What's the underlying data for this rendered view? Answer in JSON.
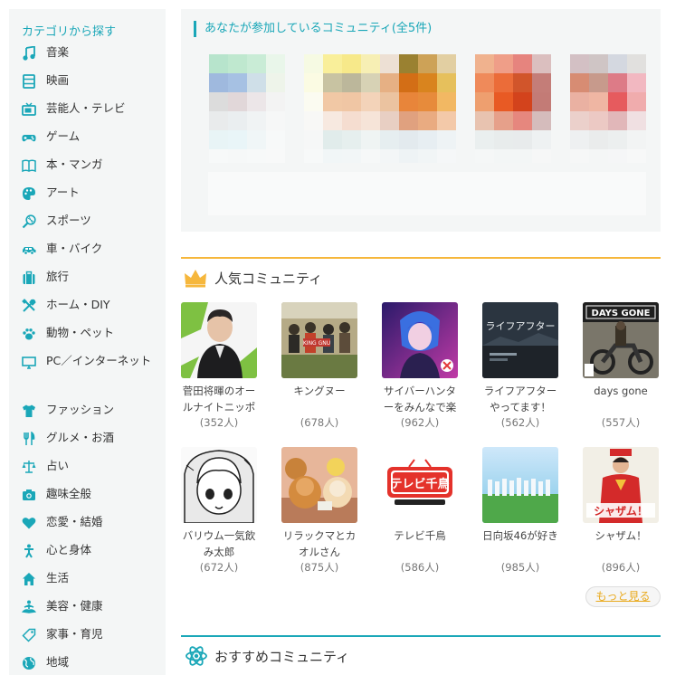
{
  "sidebar": {
    "title": "カテゴリから探す",
    "items": [
      {
        "label": "音楽",
        "icon": "music-note-icon"
      },
      {
        "label": "映画",
        "icon": "film-icon"
      },
      {
        "label": "芸能人・テレビ",
        "icon": "tv-icon"
      },
      {
        "label": "ゲーム",
        "icon": "gamepad-icon"
      },
      {
        "label": "本・マンガ",
        "icon": "book-icon"
      },
      {
        "label": "アート",
        "icon": "palette-icon"
      },
      {
        "label": "スポーツ",
        "icon": "racket-icon"
      },
      {
        "label": "車・バイク",
        "icon": "car-icon"
      },
      {
        "label": "旅行",
        "icon": "suitcase-icon"
      },
      {
        "label": "ホーム・DIY",
        "icon": "tools-icon"
      },
      {
        "label": "動物・ペット",
        "icon": "paw-icon"
      },
      {
        "label": "PC／インターネット",
        "icon": "computer-icon"
      },
      {
        "label": "ファッション",
        "icon": "tshirt-icon"
      },
      {
        "label": "グルメ・お酒",
        "icon": "fork-knife-icon"
      },
      {
        "label": "占い",
        "icon": "scales-icon"
      },
      {
        "label": "趣味全般",
        "icon": "camera-icon"
      },
      {
        "label": "恋愛・結婚",
        "icon": "heart-icon"
      },
      {
        "label": "心と身体",
        "icon": "person-icon"
      },
      {
        "label": "生活",
        "icon": "house-icon"
      },
      {
        "label": "美容・健康",
        "icon": "meditation-icon"
      },
      {
        "label": "家事・育児",
        "icon": "tag-icon"
      },
      {
        "label": "地域",
        "icon": "globe-icon"
      }
    ]
  },
  "joined": {
    "title": "あなたが参加しているコミュニティ(全5件)"
  },
  "popular": {
    "title": "人気コミュニティ",
    "icon": "crown-icon",
    "communities": [
      {
        "name": "菅田将暉のオールナイトニッポ",
        "count": "(352人)"
      },
      {
        "name": "キングヌー",
        "count": "(678人)"
      },
      {
        "name": "サイバーハンターをみんなで楽",
        "count": "(962人)"
      },
      {
        "name": "ライフアフターやってます！",
        "count": "(562人)"
      },
      {
        "name": "days gone",
        "count": "(557人)"
      },
      {
        "name": "バリウム一気飲み太郎",
        "count": "(672人)"
      },
      {
        "name": "リラックマとカオルさん",
        "count": "(875人)"
      },
      {
        "name": "テレビ千鳥",
        "count": "(586人)"
      },
      {
        "name": "日向坂46が好き",
        "count": "(985人)"
      },
      {
        "name": "シャザム！",
        "count": "(896人)"
      }
    ],
    "thumb_texts": {
      "kingnu": "KING GNU",
      "lifeafter": "ライフアフター",
      "daysgone": "DAYS GONE",
      "chidori": "テレビ千鳥",
      "shazam": "シャザム！"
    },
    "more_label": "もっと見る"
  },
  "recommend": {
    "title": "おすすめコミュニティ",
    "icon": "atom-icon"
  },
  "colors": {
    "accent": "#1aa7b8",
    "gold": "#f6b73c",
    "panel": "#f4f6f6"
  }
}
